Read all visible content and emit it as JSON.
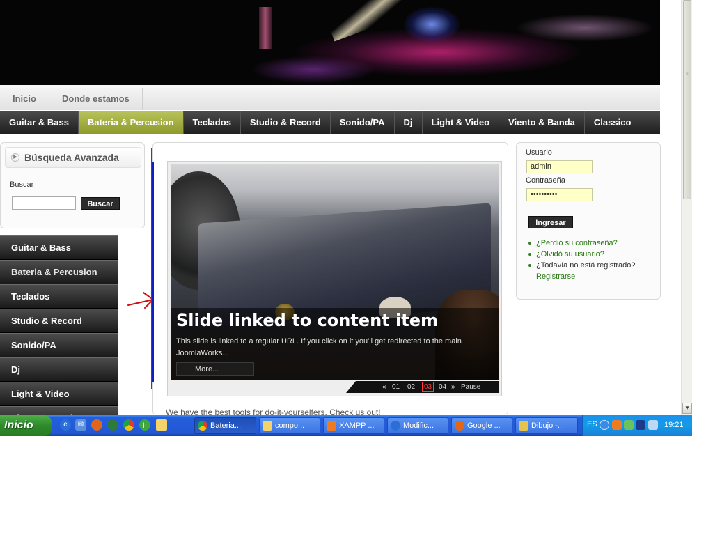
{
  "top_nav": [
    "Inicio",
    "Donde estamos"
  ],
  "category_nav": {
    "items": [
      "Guitar & Bass",
      "Bateria & Percusion",
      "Teclados",
      "Studio & Record",
      "Sonido/PA",
      "Dj",
      "Light & Video",
      "Viento & Banda",
      "Classico"
    ],
    "active": "Bateria & Percusion"
  },
  "search": {
    "title": "Búsqueda Avanzada",
    "label": "Buscar",
    "input_value": "",
    "button": "Buscar"
  },
  "side_menu": [
    "Guitar & Bass",
    "Bateria & Percusion",
    "Teclados",
    "Studio & Record",
    "Sonido/PA",
    "Dj",
    "Light & Video",
    "Viento & Banda"
  ],
  "slider": {
    "title": "Slide linked to content item",
    "description": "This slide is linked to a regular URL. If you click on it you'll get redirected to the main JoomlaWorks...",
    "more": "More...",
    "nav": {
      "prev": "«",
      "pages": [
        "01",
        "02",
        "03",
        "04"
      ],
      "current_page": "03",
      "next": "»",
      "pause": "Pause"
    }
  },
  "content_text": "We have the best tools for do-it-yourselfers. Check us out!",
  "login": {
    "username_label": "Usuario",
    "username_value": "admin",
    "password_label": "Contraseña",
    "password_value": "••••••••••",
    "submit": "Ingresar",
    "links": [
      "¿Perdió su contraseña?",
      "¿Olvidó su usuario?"
    ],
    "register_prompt": "¿Todavía no está registrado?",
    "register_link": "Registrarse"
  },
  "taskbar": {
    "start": "Inicio",
    "windows": [
      "Bateria...",
      "compo...",
      "XAMPP ...",
      "Modific...",
      "Google ...",
      "Dibujo -..."
    ],
    "active_window": "Bateria...",
    "language": "ES",
    "clock": "19:21"
  },
  "colors": {
    "accent_active": "#a3ad42",
    "link_green": "#2a7a14",
    "annotation_red": "#d01010",
    "annotation_blue": "#1020c0"
  },
  "icons": {
    "quicklaunch": [
      "ie-icon",
      "outlook-icon",
      "firefox-icon",
      "seamonkey-icon",
      "chrome-icon",
      "utorrent-icon",
      "folder-icon"
    ]
  }
}
